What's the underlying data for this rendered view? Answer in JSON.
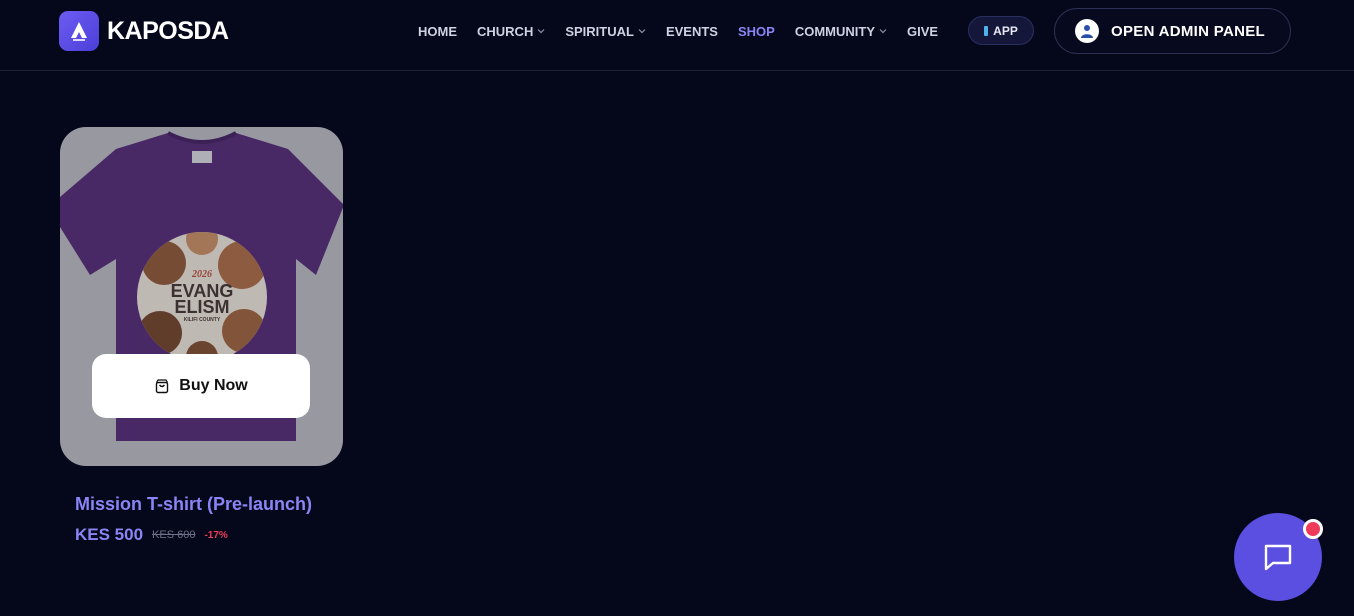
{
  "header": {
    "brand": "KAPOSDA",
    "nav": [
      {
        "label": "HOME",
        "dropdown": false
      },
      {
        "label": "CHURCH",
        "dropdown": true
      },
      {
        "label": "SPIRITUAL",
        "dropdown": true
      },
      {
        "label": "EVENTS",
        "dropdown": false
      },
      {
        "label": "SHOP",
        "dropdown": false,
        "active": true
      },
      {
        "label": "COMMUNITY",
        "dropdown": true
      },
      {
        "label": "GIVE",
        "dropdown": false
      }
    ],
    "app_label": "APP",
    "admin_label": "OPEN ADMIN PANEL"
  },
  "product": {
    "title": "Mission T-shirt (Pre-launch)",
    "price": "KES 500",
    "old_price": "KES 600",
    "discount": "-17%",
    "buy_label": "Buy Now",
    "print_year": "2026",
    "print_line1": "EVANG",
    "print_line2": "ELISM",
    "print_line3": "KILIFI COUNTY"
  },
  "colors": {
    "background": "#05071a",
    "accent": "#8b84f5",
    "chat": "#5a4fe0",
    "discount": "#ef3b5a",
    "shirt": "#4a1f6e"
  },
  "icons": {
    "logo": "church-logo-icon",
    "app": "phone-icon",
    "buy": "shopping-bag-icon",
    "chat": "chat-bubble-icon"
  }
}
